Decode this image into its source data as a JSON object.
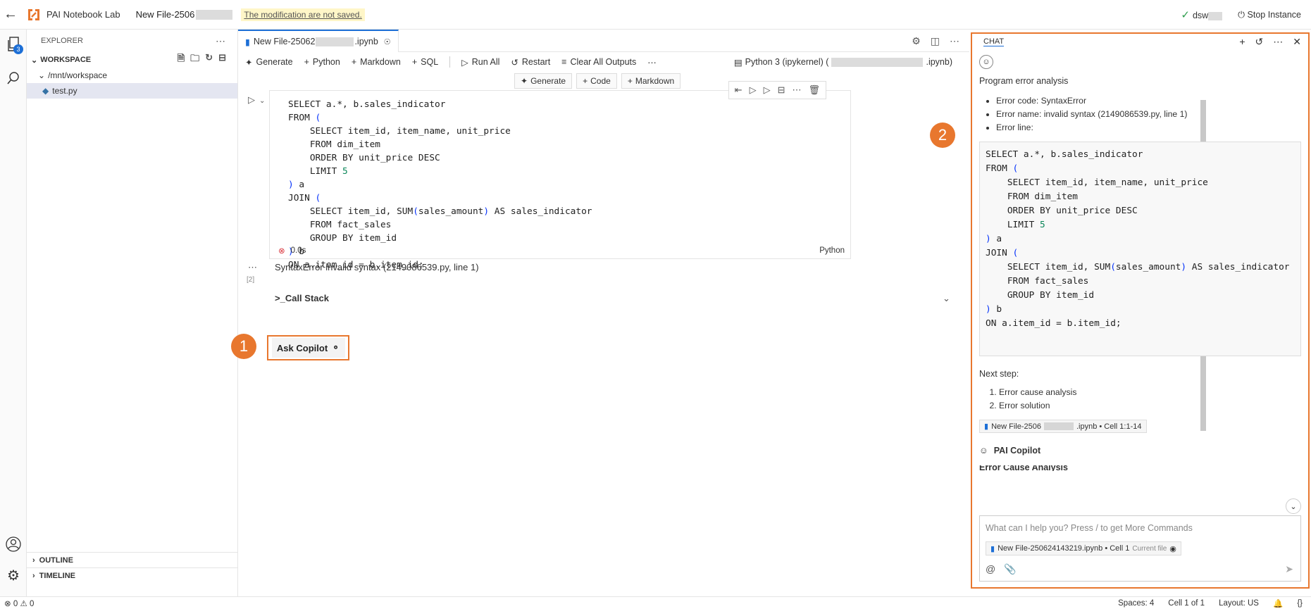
{
  "topbar": {
    "app_name": "PAI Notebook Lab",
    "file_name": "New File-2506",
    "unsaved_notice": "The modification are not saved.",
    "instance_name": "dsw",
    "stop_label": "Stop Instance"
  },
  "activity": {
    "explorer_badge": "3"
  },
  "explorer": {
    "title": "EXPLORER",
    "workspace_label": "WORKSPACE",
    "folder": "/mnt/workspace",
    "file": "test.py",
    "outline_label": "OUTLINE",
    "timeline_label": "TIMELINE"
  },
  "editor": {
    "tab_label_prefix": "New File-25062",
    "tab_label_suffix": ".ipynb",
    "toolbar": {
      "generate": "Generate",
      "python": "Python",
      "markdown": "Markdown",
      "sql": "SQL",
      "run_all": "Run All",
      "restart": "Restart",
      "clear_outputs": "Clear All Outputs",
      "kernel_prefix": "Python 3 (ipykernel) (",
      "kernel_suffix": ".ipynb)"
    },
    "insert": {
      "generate": "Generate",
      "code": "Code",
      "markdown": "Markdown"
    },
    "cell": {
      "exec_count": "[2]",
      "duration": "0.0s",
      "language": "Python"
    },
    "output": {
      "error_text": "SyntaxError invalid syntax (2149086539.py, line 1)",
      "call_stack": "Call Stack",
      "ask_copilot": "Ask Copilot"
    }
  },
  "code_lines": [
    "SELECT a.*, b.sales_indicator",
    "FROM (",
    "    SELECT item_id, item_name, unit_price",
    "    FROM dim_item",
    "    ORDER BY unit_price DESC",
    "    LIMIT 5",
    ") a",
    "JOIN (",
    "    SELECT item_id, SUM(sales_amount) AS sales_indicator",
    "    FROM fact_sales",
    "    GROUP BY item_id",
    ") b",
    "ON a.item_id = b.item_id;"
  ],
  "markers": {
    "one": "1",
    "two": "2"
  },
  "chat": {
    "title": "CHAT",
    "heading": "Program error analysis",
    "bullets": [
      "Error code: SyntaxError",
      "Error name: invalid syntax (2149086539.py, line 1)",
      "Error line:"
    ],
    "next_step": "Next step:",
    "steps": [
      "Error cause analysis",
      "Error solution"
    ],
    "ref_prefix": "New File-2506",
    "ref_suffix": ".ipynb • Cell 1:1-14",
    "assistant_name": "PAI Copilot",
    "truncated_text": "Error Cause Analysis",
    "input_placeholder": "What can I help you? Press / to get More Commands",
    "context_file": "New File-250624143219.ipynb • Cell 1",
    "context_tag": "Current file"
  },
  "statusbar": {
    "problems": "0",
    "warnings": "0",
    "spaces": "Spaces: 4",
    "cell": "Cell 1 of 1",
    "layout": "Layout: US"
  },
  "colors": {
    "accent": "#e8772e",
    "blue": "#1d6fd6"
  }
}
